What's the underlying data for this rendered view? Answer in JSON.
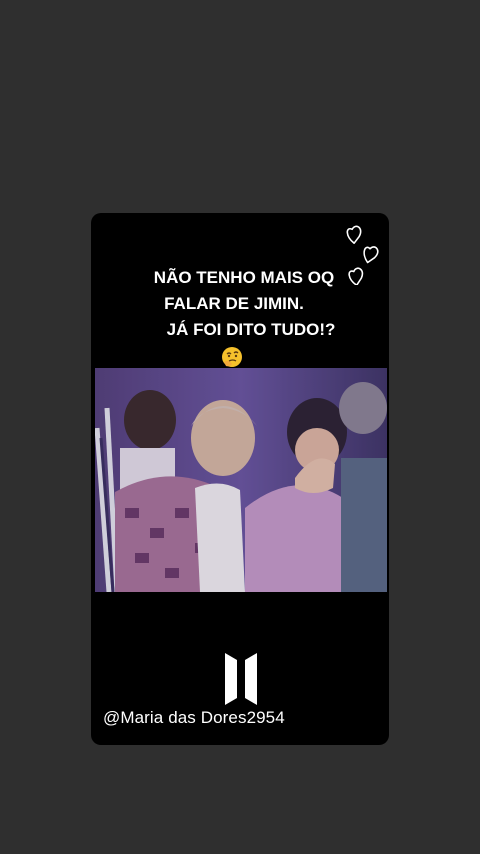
{
  "story": {
    "caption_line1": "NÃO TENHO MAIS OQ",
    "caption_line2": "FALAR DE JIMIN.",
    "caption_line3": "JÁ FOI DITO TUDO!?",
    "emoji": "thinking-face-icon",
    "hearts": "hearts-doodle-icon",
    "video": "concert-video-frame",
    "logo": "bts-logo-icon",
    "watermark": "@Maria das Dores2954"
  },
  "colors": {
    "background": "#2f2f2f",
    "card": "#000000",
    "text": "#ffffff"
  }
}
